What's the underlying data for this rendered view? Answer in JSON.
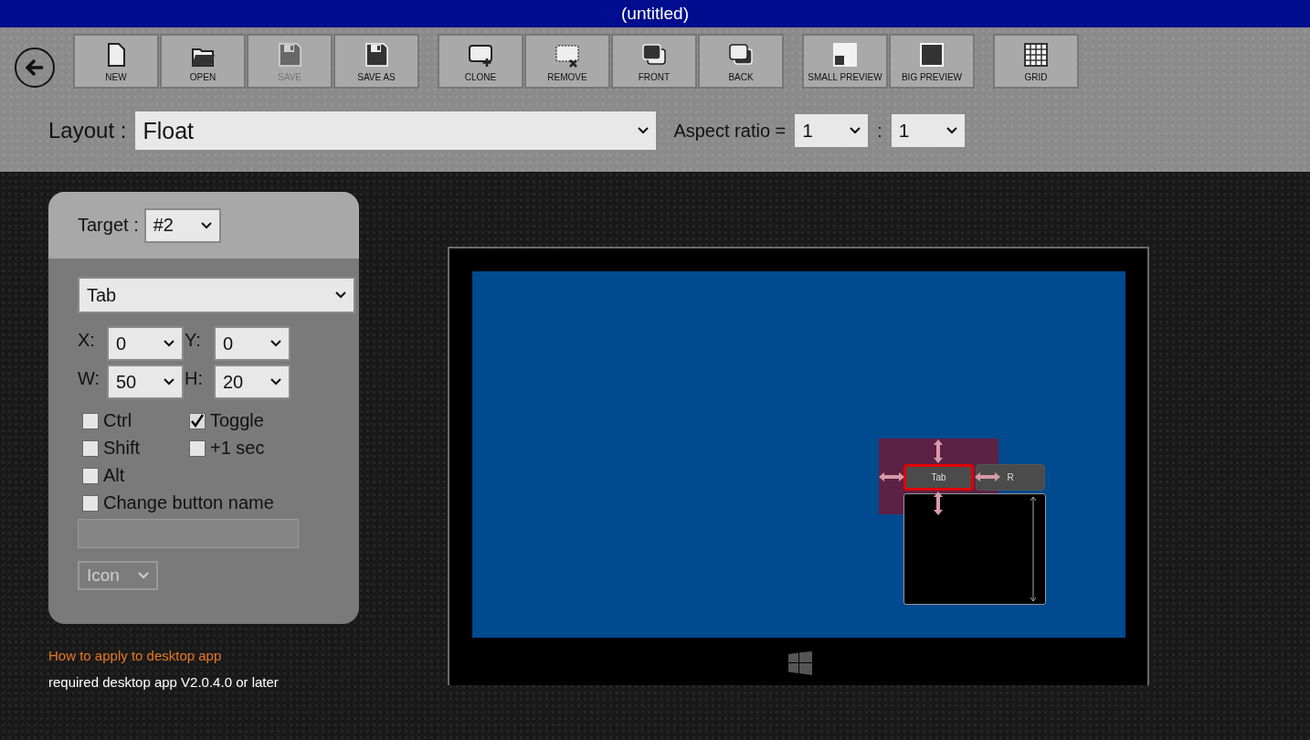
{
  "window": {
    "title": "(untitled)"
  },
  "toolbar": {
    "groups": [
      [
        {
          "label": "NEW",
          "kind": "new",
          "disabled": false
        },
        {
          "label": "OPEN",
          "kind": "open",
          "disabled": false
        },
        {
          "label": "SAVE",
          "kind": "save",
          "disabled": true
        },
        {
          "label": "SAVE AS",
          "kind": "save",
          "disabled": false
        }
      ],
      [
        {
          "label": "CLONE",
          "kind": "clone",
          "disabled": false
        },
        {
          "label": "REMOVE",
          "kind": "remove",
          "disabled": false
        },
        {
          "label": "FRONT",
          "kind": "front",
          "disabled": false
        },
        {
          "label": "BACK",
          "kind": "back",
          "disabled": false
        }
      ],
      [
        {
          "label": "SMALL PREVIEW",
          "kind": "small",
          "disabled": false
        },
        {
          "label": "BIG PREVIEW",
          "kind": "big",
          "disabled": false
        }
      ],
      [
        {
          "label": "GRID",
          "kind": "grid",
          "disabled": false
        }
      ]
    ]
  },
  "layout": {
    "label": "Layout :",
    "value": "Float",
    "aspect_label": "Aspect ratio =",
    "aspect_w": "1",
    "aspect_separator": ":",
    "aspect_h": "1"
  },
  "panel": {
    "target_label": "Target :",
    "target": "#2",
    "key": "Tab",
    "fields": [
      {
        "label": "X:",
        "value": "0"
      },
      {
        "label": "Y:",
        "value": "0"
      },
      {
        "label": "W:",
        "value": "50"
      },
      {
        "label": "H:",
        "value": "20"
      }
    ],
    "checkboxes": [
      {
        "label": "Ctrl",
        "checked": false
      },
      {
        "label": "Toggle",
        "checked": true
      },
      {
        "label": "Shift",
        "checked": false
      },
      {
        "label": "+1 sec",
        "checked": false
      },
      {
        "label": "Alt",
        "checked": false
      },
      {
        "label": "Change button name",
        "checked": false
      }
    ],
    "name_field": {
      "disabled": true
    },
    "icon_select": {
      "value": "Icon",
      "disabled": true
    }
  },
  "link": "How to apply to desktop app",
  "note": "required desktop app V2.0.4.0 or later",
  "preview": {
    "buttons": [
      {
        "label": "Tab",
        "selected": true
      },
      {
        "label": "R",
        "selected": false
      }
    ]
  }
}
